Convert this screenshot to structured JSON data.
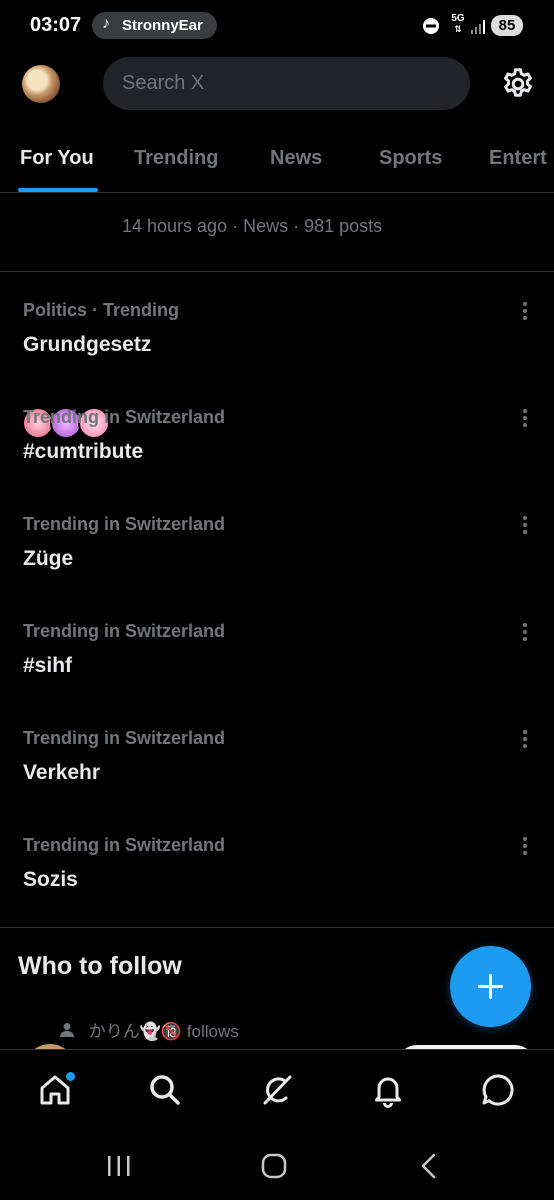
{
  "status_bar": {
    "time": "03:07",
    "media_label": "StronnyEar",
    "network": "5G",
    "battery": "85"
  },
  "header": {
    "search_placeholder": "Search X"
  },
  "tabs": [
    {
      "label": "For You",
      "active": true
    },
    {
      "label": "Trending",
      "active": false
    },
    {
      "label": "News",
      "active": false
    },
    {
      "label": "Sports",
      "active": false
    },
    {
      "label": "Entert",
      "active": false
    }
  ],
  "news_item": {
    "meta": "14 hours ago · News · 981 posts"
  },
  "trends": [
    {
      "context": "Politics · Trending",
      "name": "Grundgesetz"
    },
    {
      "context": "Trending in Switzerland",
      "name": "#cumtribute"
    },
    {
      "context": "Trending in Switzerland",
      "name": "Züge"
    },
    {
      "context": "Trending in Switzerland",
      "name": "#sihf"
    },
    {
      "context": "Trending in Switzerland",
      "name": "Verkehr"
    },
    {
      "context": "Trending in Switzerland",
      "name": "Sozis"
    }
  ],
  "who_to_follow": {
    "title": "Who to follow",
    "follows_text": "かりん👻🔞 follows"
  },
  "colors": {
    "accent": "#1d9bf0",
    "background": "#000000",
    "secondary_text": "#71767b",
    "primary_text": "#e7e9ea"
  },
  "icons": {
    "nav": [
      "home-icon",
      "search-icon",
      "grok-icon",
      "notifications-icon",
      "messages-icon"
    ],
    "system": [
      "recents-icon",
      "home-button-icon",
      "back-icon"
    ]
  }
}
